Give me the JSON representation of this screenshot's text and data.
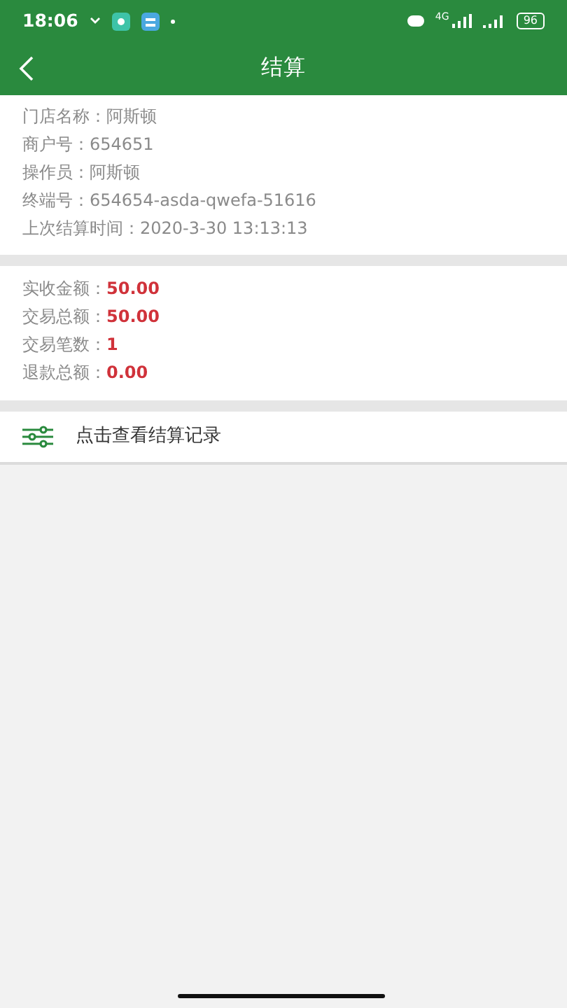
{
  "status_bar": {
    "time": "18:06",
    "network": "4G",
    "battery": "96"
  },
  "header": {
    "title": "结算"
  },
  "store_info": [
    "门店名称：阿斯顿",
    "商户号：654651",
    "操作员：阿斯顿",
    "终端号：654654-asda-qwefa-51616",
    "上次结算时间：2020-3-30 13:13:13"
  ],
  "summary": [
    {
      "label": "实收金额：",
      "value": "50.00"
    },
    {
      "label": "交易总额：",
      "value": "50.00"
    },
    {
      "label": "交易笔数：",
      "value": "1"
    },
    {
      "label": "退款总额：",
      "value": "0.00"
    }
  ],
  "records_link": {
    "label": "点击查看结算记录"
  }
}
